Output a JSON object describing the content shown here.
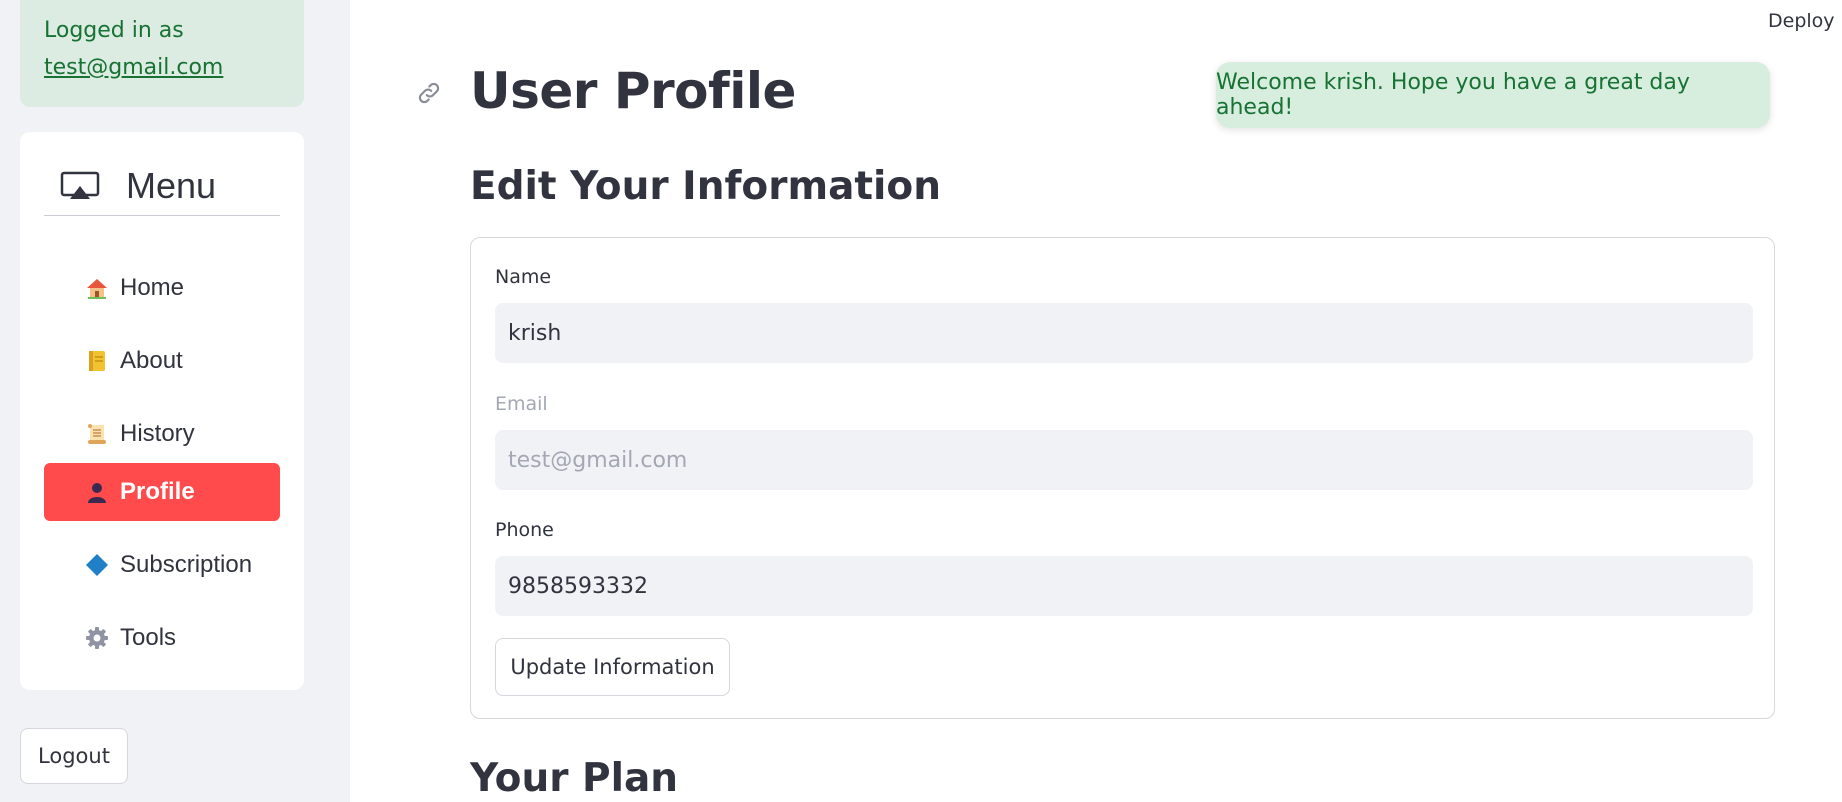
{
  "sidebar": {
    "login": {
      "prefix": "Logged in as",
      "email": "test@gmail.com"
    },
    "menu": {
      "title": "Menu",
      "icon": "cast-icon",
      "items": [
        {
          "label": "Home",
          "icon": "house-icon",
          "active": false
        },
        {
          "label": "About",
          "icon": "notebook-icon",
          "active": false
        },
        {
          "label": "History",
          "icon": "scroll-icon",
          "active": false
        },
        {
          "label": "Profile",
          "icon": "user-silhouette-icon",
          "active": true
        },
        {
          "label": "Subscription",
          "icon": "diamond-icon",
          "active": false
        },
        {
          "label": "Tools",
          "icon": "gear-icon",
          "active": false
        }
      ]
    },
    "logout_label": "Logout"
  },
  "header": {
    "deploy_label": "Deploy"
  },
  "main": {
    "title": "User Profile",
    "toast": "Welcome krish. Hope you have a great day ahead!",
    "edit_section": {
      "title": "Edit Your Information",
      "fields": {
        "name": {
          "label": "Name",
          "value": "krish",
          "disabled": false
        },
        "email": {
          "label": "Email",
          "value": "test@gmail.com",
          "disabled": true
        },
        "phone": {
          "label": "Phone",
          "value": "9858593332",
          "disabled": false
        }
      },
      "submit_label": "Update Information"
    },
    "plan_section": {
      "title": "Your Plan"
    }
  },
  "colors": {
    "accent": "#ff4b4b",
    "success_bg": "#dcece3",
    "success_text": "#177233",
    "input_bg": "#f0f2f6",
    "sidebar_bg": "#f0f2f6"
  }
}
